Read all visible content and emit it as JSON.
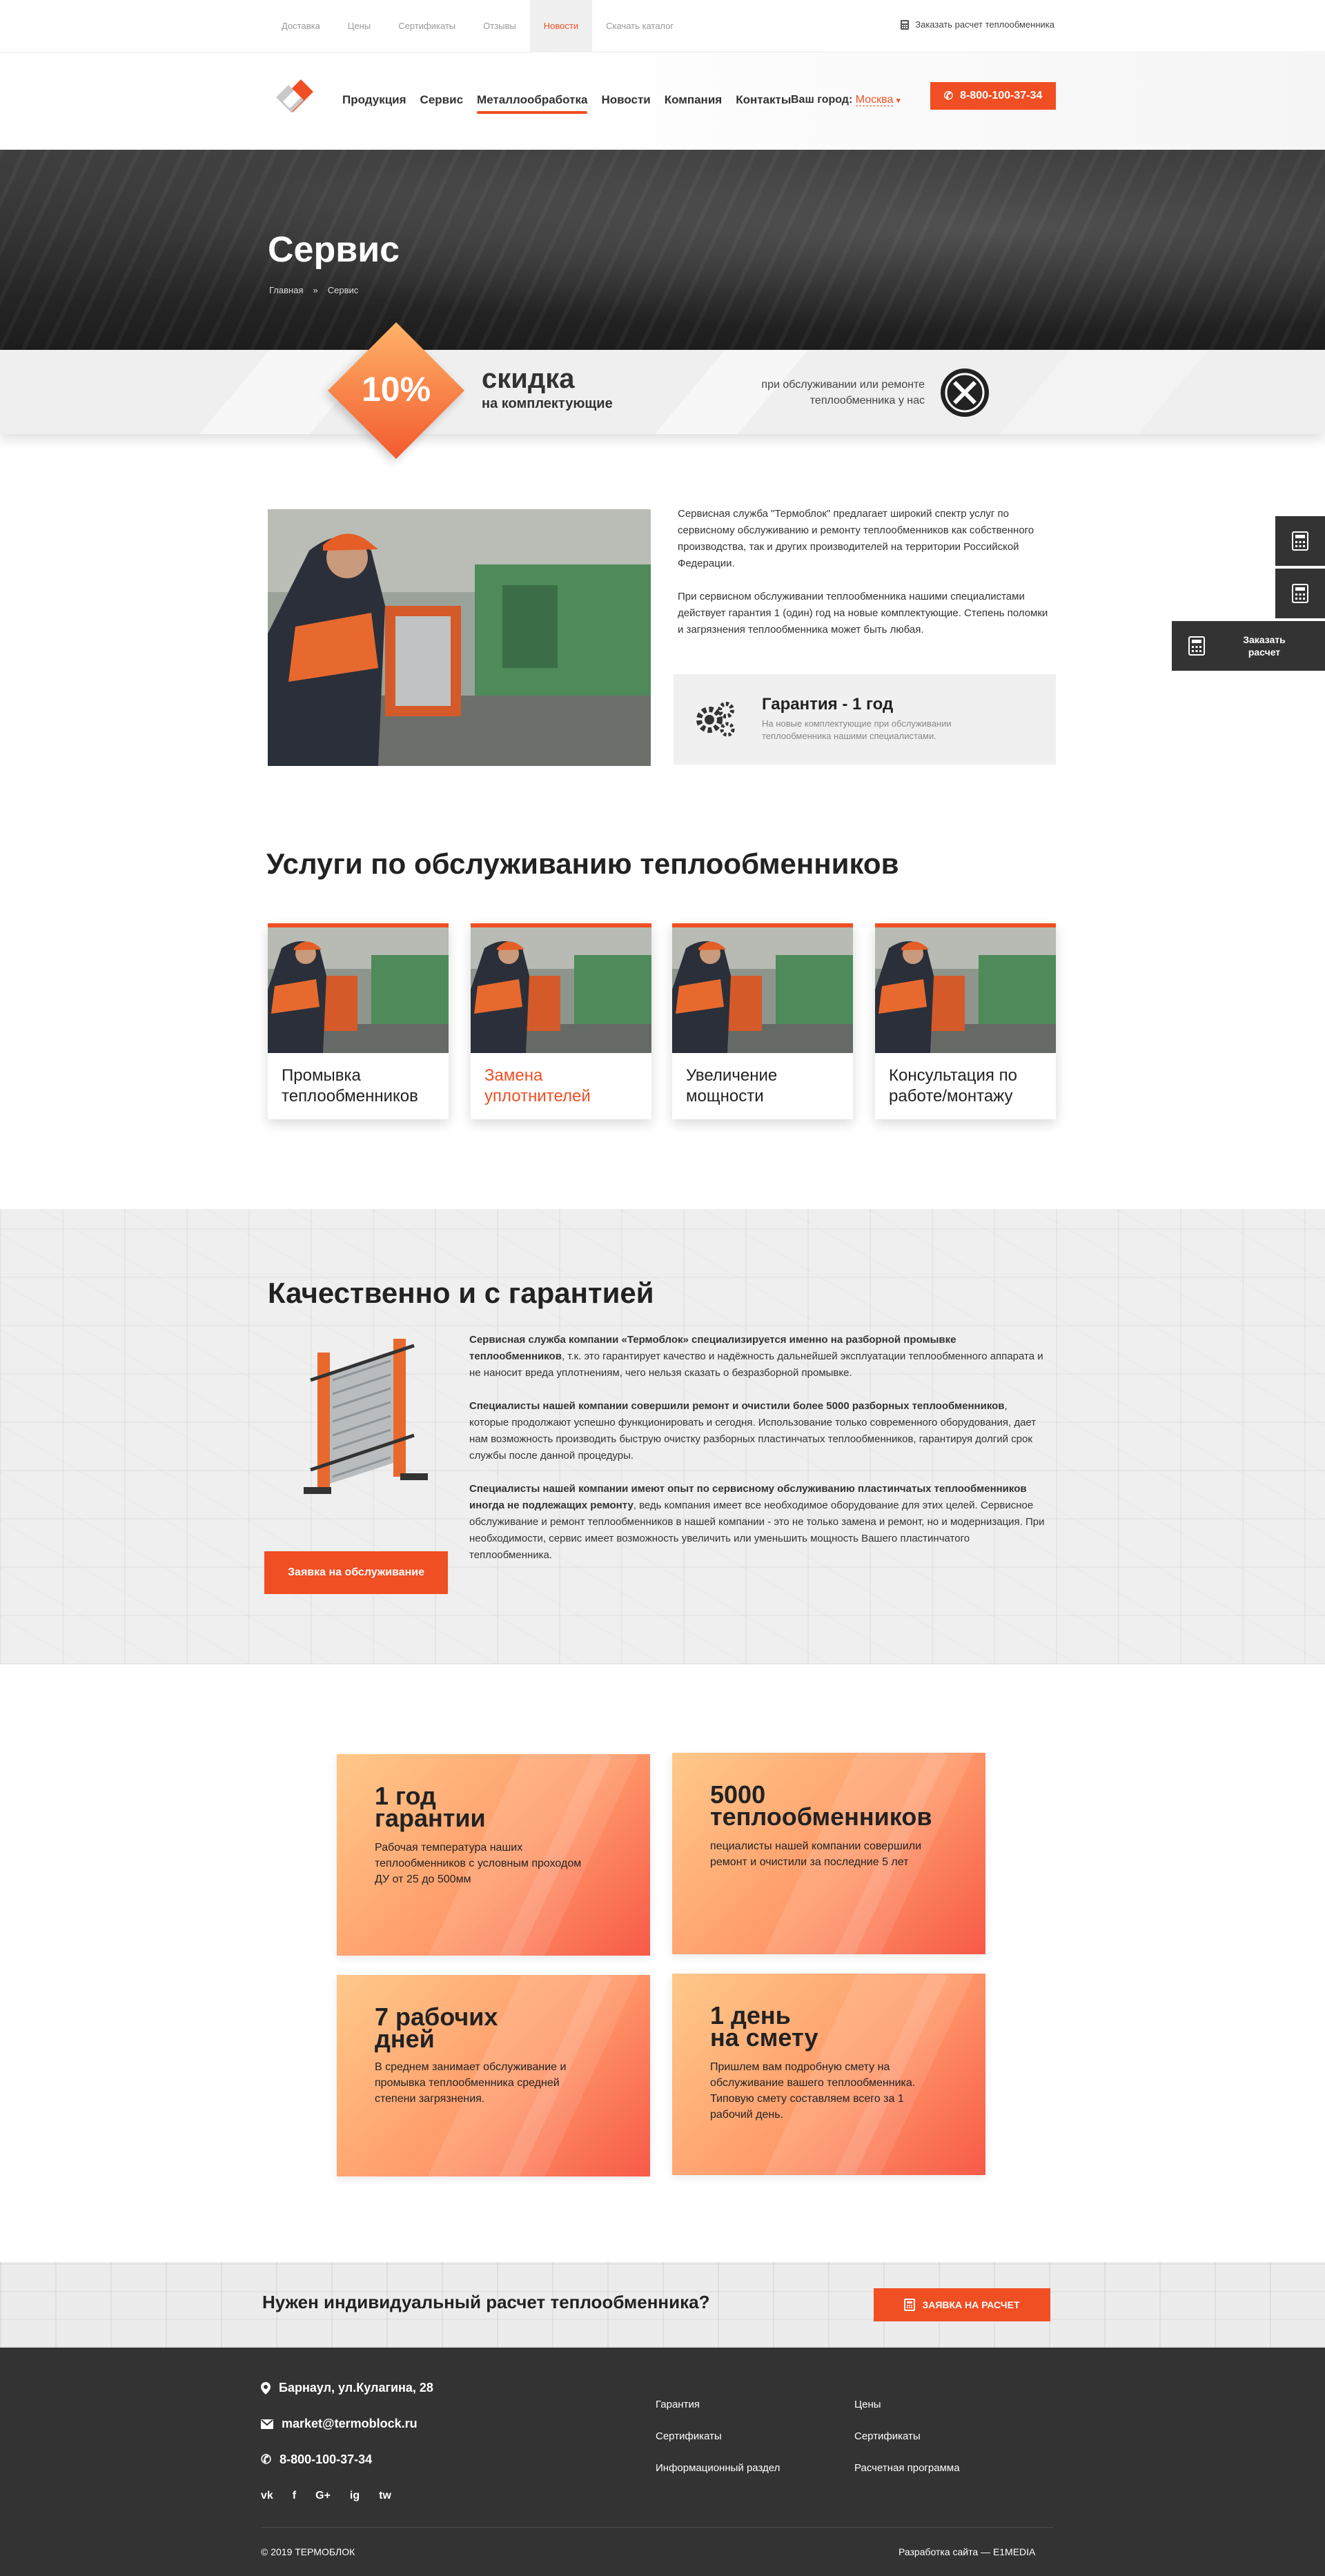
{
  "topbar": {
    "links": [
      "Доставка",
      "Цены",
      "Сертификаты",
      "Отзывы",
      "Новости",
      "Скачать каталог"
    ],
    "active_index": 4,
    "order_calc": "Заказать расчет теплообменника"
  },
  "header": {
    "nav": [
      "Продукция",
      "Сервис",
      "Металлообработка",
      "Новости",
      "Компания",
      "Контакты"
    ],
    "active_nav": "Металлообработка",
    "city_label": "Ваш город:",
    "city_value": "Москва",
    "phone": "8-800-100-37-34"
  },
  "hero": {
    "title": "Сервис",
    "breadcrumbs": [
      "Главная",
      "»",
      "Сервис"
    ]
  },
  "promo": {
    "percent": "10%",
    "title": "скидка",
    "subtitle": "на комплектующие",
    "right_text": "при обслуживании или ремонте теплообменника у нас"
  },
  "intro": {
    "p1": "Сервисная служба \"Термоблок\" предлагает широкий спектр услуг по сервисному обслуживанию и ремонту теплообменников как собственного производства, так и других производителей на территории Российской Федерации.",
    "p2": "При сервисном обслуживании теплообменника нашими специалистами действует гарантия 1 (один) год на новые комплектующие. Степень поломки и загрязнения теплообменника может быть любая.",
    "guarantee_title": "Гарантия - 1 год",
    "guarantee_text": "На новые комплектующие при обслуживании теплообменника нашими специалистами."
  },
  "side": {
    "calc_label_1": "Заказать",
    "calc_label_2": "расчет"
  },
  "services": {
    "title": "Услуги по обслуживанию теплообменников",
    "cards": [
      {
        "line1": "Промывка",
        "line2": "теплообменников"
      },
      {
        "line1": "Замена",
        "line2": "уплотнителей"
      },
      {
        "line1": "Увеличение",
        "line2": "мощности"
      },
      {
        "line1": "Консультация по",
        "line2": "работе/монтажу"
      }
    ],
    "highlight_index": 1
  },
  "quality": {
    "title": "Качественно и с гарантией",
    "p1_bold": "Сервисная служба компании «Термоблок» специализируется именно на разборной промывке теплообменников",
    "p1_rest": ", т.к. это гарантирует качество и надёжность дальнейшей эксплуатации теплообменного аппарата и не наносит вреда уплотнениям, чего нельзя сказать о безразборной промывке.",
    "p2_bold": "Специалисты нашей компании совершили ремонт и очистили более 5000 разборных теплообменников",
    "p2_rest": ", которые продолжают успешно функционировать и сегодня. Использование только современного оборудования, дает нам возможность производить быструю очистку разборных пластинчатых теплообменников, гарантируя долгий срок службы после данной процедуры.",
    "p3_bold": "Специалисты нашей компании имеют опыт по сервисному обслуживанию пластинчатых теплообменников иногда не подлежащих ремонту",
    "p3_rest": ", ведь компания имеет все необходимое оборудование для этих целей. Сервисное обслуживание и ремонт теплообменников в нашей компании - это не только замена и ремонт, но и модернизация. При необходимости, сервис имеет возможность увеличить или уменьшить мощность Вашего пластинчатого теплообменника.",
    "button": "Заявка на обслуживание"
  },
  "stats": [
    {
      "title1": "1 год",
      "title2": "гарантии",
      "text": "Рабочая температура наших теплообменников с условным проходом ДУ от 25 до 500мм"
    },
    {
      "title1": "5000",
      "title2": "теплообменников",
      "text": "пециалисты нашей компании совершили ремонт и очистили за последние 5 лет"
    },
    {
      "title1": "7 рабочих",
      "title2": "дней",
      "text": "В среднем занимает обслуживание и промывка теплообменника средней степени загрязнения."
    },
    {
      "title1": "1 день",
      "title2": "на смету",
      "text": "Пришлем вам подробную смету на обслуживание вашего теплообменника. Типовую смету составляем всего за 1 рабочий день."
    }
  ],
  "cta": {
    "title": "Нужен индивидуальный расчет теплообменника?",
    "button": "ЗАЯВКА НА РАСЧЕТ"
  },
  "footer": {
    "address": "Барнаул, ул.Кулагина, 28",
    "email": "market@termoblock.ru",
    "phone": "8-800-100-37-34",
    "col1": [
      "Гарантия",
      "Сертификаты",
      "Информационный раздел"
    ],
    "col2": [
      "Цены",
      "Сертификаты",
      "Расчетная программа"
    ],
    "social": [
      "vk",
      "f",
      "G+",
      "ig",
      "tw"
    ],
    "copyright": "© 2019 ТЕРМОБЛОК",
    "developer": "Разработка сайта — E1MEDIA"
  },
  "colors": {
    "accent": "#f04e23",
    "dark": "#333333"
  }
}
